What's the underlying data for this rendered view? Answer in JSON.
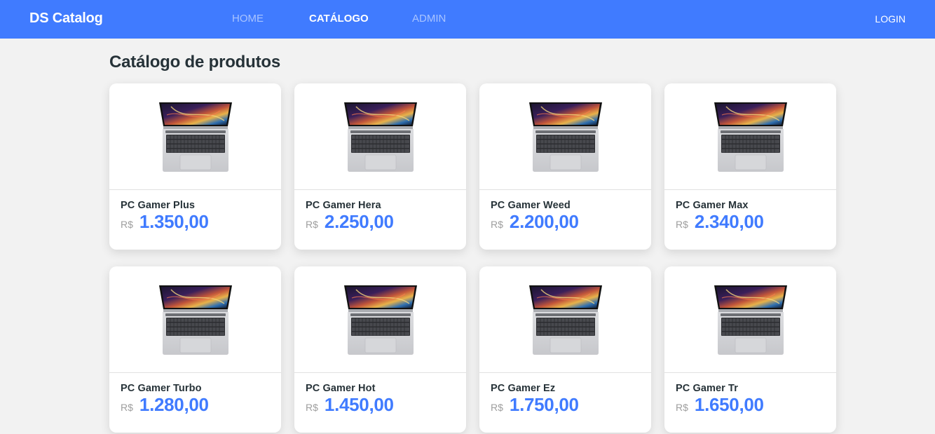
{
  "navbar": {
    "brand": "DS Catalog",
    "links": [
      {
        "label": "HOME",
        "active": false
      },
      {
        "label": "CATÁLOGO",
        "active": true
      },
      {
        "label": "ADMIN",
        "active": false
      }
    ],
    "login": "LOGIN"
  },
  "page": {
    "title": "Catálogo de produtos"
  },
  "colors": {
    "primary": "#407bff",
    "background": "#f2f2f2",
    "text": "#263238",
    "muted": "#9e9e9e"
  },
  "products": [
    {
      "name": "PC Gamer Plus",
      "currency": "R$",
      "price": "1.350,00",
      "image": "laptop-image"
    },
    {
      "name": "PC Gamer Hera",
      "currency": "R$",
      "price": "2.250,00",
      "image": "laptop-image"
    },
    {
      "name": "PC Gamer Weed",
      "currency": "R$",
      "price": "2.200,00",
      "image": "laptop-image"
    },
    {
      "name": "PC Gamer Max",
      "currency": "R$",
      "price": "2.340,00",
      "image": "laptop-image"
    },
    {
      "name": "PC Gamer Turbo",
      "currency": "R$",
      "price": "1.280,00",
      "image": "laptop-image"
    },
    {
      "name": "PC Gamer Hot",
      "currency": "R$",
      "price": "1.450,00",
      "image": "laptop-image"
    },
    {
      "name": "PC Gamer Ez",
      "currency": "R$",
      "price": "1.750,00",
      "image": "laptop-image"
    },
    {
      "name": "PC Gamer Tr",
      "currency": "R$",
      "price": "1.650,00",
      "image": "laptop-image"
    }
  ]
}
